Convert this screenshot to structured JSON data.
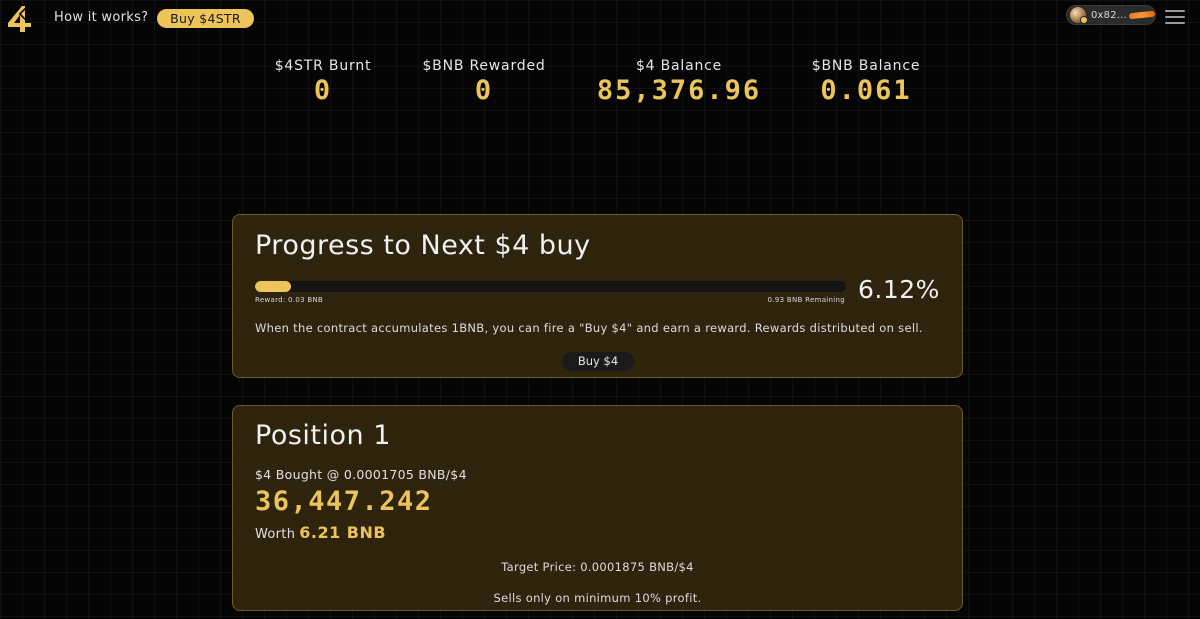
{
  "header": {
    "logo_icon": "four-logo-icon",
    "how_it_works": "How it works?",
    "buy_button": "Buy $4STR",
    "wallet": {
      "address": "0x82...",
      "avatar_icon": "avatar-icon"
    },
    "menu_icon": "hamburger-menu-icon"
  },
  "stats": [
    {
      "label": "$4STR Burnt",
      "value": "0"
    },
    {
      "label": "$BNB Rewarded",
      "value": "0"
    },
    {
      "label": "$4 Balance",
      "value": "85,376.96"
    },
    {
      "label": "$BNB Balance",
      "value": "0.061"
    }
  ],
  "progress_card": {
    "title": "Progress to Next $4 buy",
    "progress_fraction": 0.0612,
    "reward_label": "Reward: 0.03 BNB",
    "remaining_label": "0.93 BNB Remaining",
    "percent_text": "6.12%",
    "description": "When the contract accumulates 1BNB, you can fire a \"Buy $4\" and earn a reward. Rewards distributed on sell.",
    "button_label": "Buy $4"
  },
  "position_card": {
    "title": "Position 1",
    "bought_label": "$4 Bought @ 0.0001705 BNB/$4",
    "amount": "36,447.242",
    "worth_label": "Worth",
    "worth_value": "6.21 BNB",
    "target_price": "Target Price: 0.0001875 BNB/$4",
    "note": "Sells only on minimum 10% profit."
  },
  "colors": {
    "accent": "#ecc45a",
    "card_bg": "#3e3110",
    "card_border": "#6d5a2a",
    "background": "#050505"
  }
}
